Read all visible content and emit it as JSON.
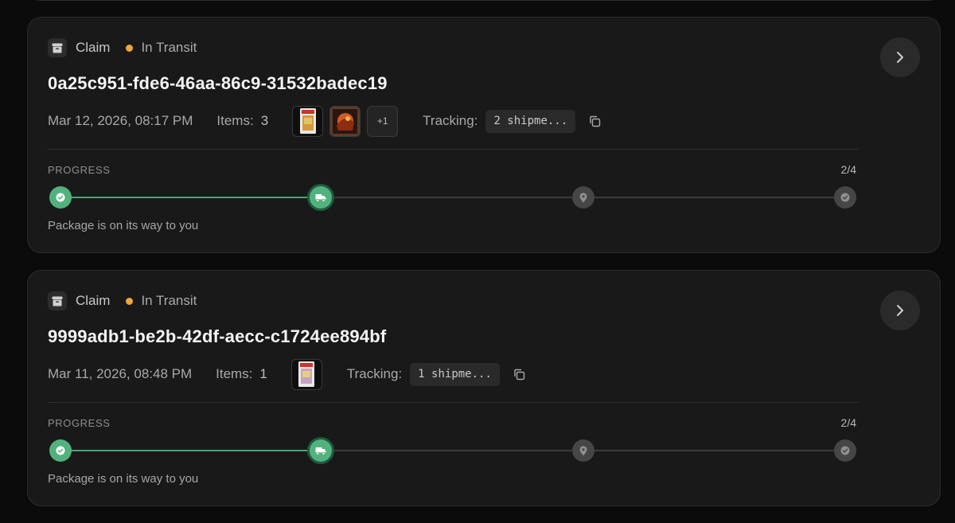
{
  "claims": [
    {
      "type_label": "Claim",
      "status": "In Transit",
      "id": "0a25c951-fde6-46aa-86c9-31532badec19",
      "date": "Mar 12, 2026, 08:17 PM",
      "items_label": "Items:",
      "items_count": "3",
      "more_thumbs": "+1",
      "tracking_label": "Tracking:",
      "tracking_value": "2 shipme...",
      "progress_label": "PROGRESS",
      "progress_count": "2/4",
      "progress_fraction": 0.5,
      "progress_desc": "Package is on its way to you"
    },
    {
      "type_label": "Claim",
      "status": "In Transit",
      "id": "9999adb1-be2b-42df-aecc-c1724ee894bf",
      "date": "Mar 11, 2026, 08:48 PM",
      "items_label": "Items:",
      "items_count": "1",
      "tracking_label": "Tracking:",
      "tracking_value": "1 shipme...",
      "progress_label": "PROGRESS",
      "progress_count": "2/4",
      "progress_fraction": 0.5,
      "progress_desc": "Package is on its way to you"
    }
  ],
  "colors": {
    "status_in_transit": "#f0a63a",
    "progress_done": "#52b27d",
    "progress_todo": "#464646"
  },
  "icons": {
    "type": "archive-box-icon",
    "open": "chevron-right-icon",
    "copy": "copy-icon",
    "steps": [
      "check-icon",
      "truck-icon",
      "map-pin-icon",
      "check-circle-icon"
    ]
  }
}
